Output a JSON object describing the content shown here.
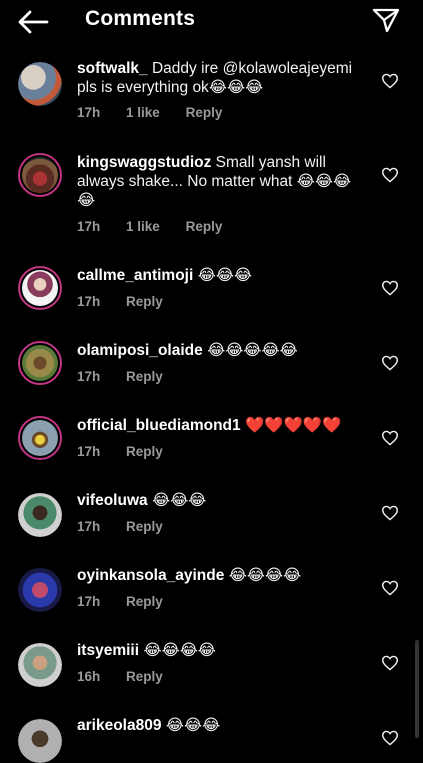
{
  "header": {
    "title": "Comments"
  },
  "comments": [
    {
      "username": "softwalk_",
      "text": "Daddy ire @kolawoleajeyemi pls is everything ok😂😂😂",
      "time": "17h",
      "likes": "1 like",
      "reply": "Reply"
    },
    {
      "username": "kingswaggstudioz",
      "text": "Small yansh will always shake... No matter what 😂😂😂😂",
      "time": "17h",
      "likes": "1 like",
      "reply": "Reply"
    },
    {
      "username": "callme_antimoji",
      "text": "😂😂😂",
      "time": "17h",
      "reply": "Reply"
    },
    {
      "username": "olamiposi_olaide",
      "text": "😂😂😂😂😂",
      "time": "17h",
      "reply": "Reply"
    },
    {
      "username": "official_bluediamond1",
      "text": "❤️❤️❤️❤️❤️",
      "time": "17h",
      "reply": "Reply"
    },
    {
      "username": "vifeoluwa",
      "text": "😂😂😂",
      "time": "17h",
      "reply": "Reply"
    },
    {
      "username": "oyinkansola_ayinde",
      "text": "😂😂😂😂",
      "time": "17h",
      "reply": "Reply"
    },
    {
      "username": "itsyemiii",
      "text": "😂😂😂😂",
      "time": "16h",
      "reply": "Reply"
    },
    {
      "username": "arikeola809",
      "text": "😂😂😂",
      "time": "",
      "reply": ""
    }
  ],
  "icons": {
    "back": "arrow-left-icon",
    "send": "paper-plane-icon",
    "like": "heart-outline-icon"
  },
  "colors": {
    "background": "#000000",
    "text": "#ffffff",
    "meta": "#9a9a9a",
    "story_ring": "#c13584"
  }
}
